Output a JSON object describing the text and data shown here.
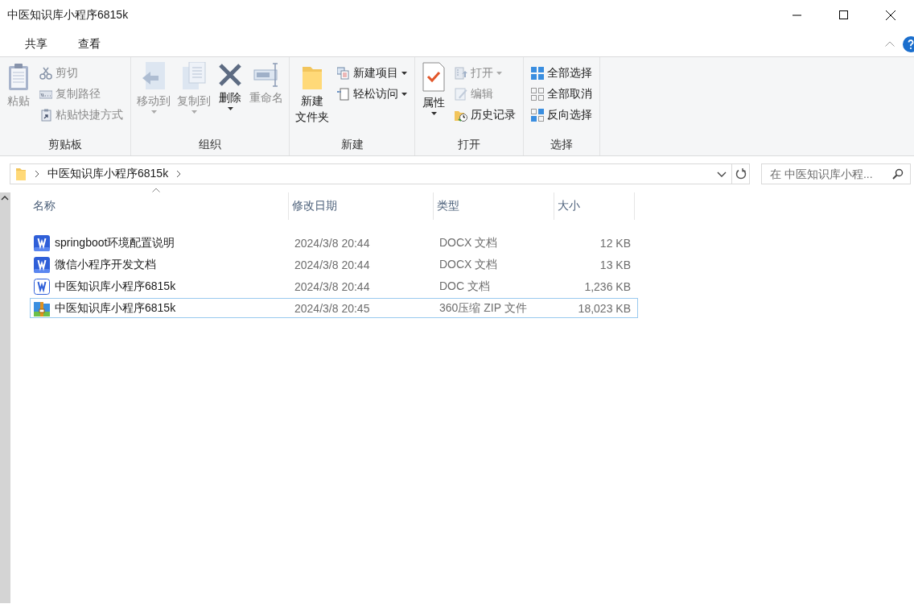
{
  "window": {
    "title": "中医知识库小程序6815k"
  },
  "ribbon_tabs": [
    {
      "label": "共享",
      "selected": false
    },
    {
      "label": "查看",
      "selected": false
    }
  ],
  "ribbon_groups": [
    {
      "label": "剪贴板",
      "items": [
        {
          "kind": "large",
          "label": "粘贴",
          "disabled": true,
          "dropdown": false
        },
        {
          "kind": "small",
          "label": "剪切",
          "disabled": true,
          "dropdown": false
        },
        {
          "kind": "small",
          "label": "复制路径",
          "disabled": true,
          "dropdown": false
        },
        {
          "kind": "small",
          "label": "粘贴快捷方式",
          "disabled": true,
          "dropdown": false
        }
      ]
    },
    {
      "label": "组织",
      "items": [
        {
          "kind": "large",
          "label": "移动到",
          "disabled": true,
          "dropdown": true
        },
        {
          "kind": "large",
          "label": "复制到",
          "disabled": true,
          "dropdown": true
        },
        {
          "kind": "large",
          "label": "删除",
          "disabled": false,
          "dropdown": true
        },
        {
          "kind": "large",
          "label": "重命名",
          "disabled": true,
          "dropdown": false
        }
      ]
    },
    {
      "label": "新建",
      "items": [
        {
          "kind": "large",
          "label": [
            "新建",
            "文件夹"
          ],
          "disabled": false,
          "dropdown": false
        },
        {
          "kind": "small",
          "label": "新建项目",
          "disabled": false,
          "dropdown": true
        },
        {
          "kind": "small",
          "label": "轻松访问",
          "disabled": false,
          "dropdown": true
        }
      ]
    },
    {
      "label": "打开",
      "items": [
        {
          "kind": "large",
          "label": "属性",
          "disabled": false,
          "dropdown": true
        },
        {
          "kind": "small",
          "label": "打开",
          "disabled": true,
          "dropdown": true
        },
        {
          "kind": "small",
          "label": "编辑",
          "disabled": true,
          "dropdown": false
        },
        {
          "kind": "small",
          "label": "历史记录",
          "disabled": false,
          "dropdown": false
        }
      ]
    },
    {
      "label": "选择",
      "items": [
        {
          "kind": "small",
          "label": "全部选择",
          "disabled": false,
          "dropdown": false
        },
        {
          "kind": "small",
          "label": "全部取消",
          "disabled": false,
          "dropdown": false
        },
        {
          "kind": "small",
          "label": "反向选择",
          "disabled": false,
          "dropdown": false
        }
      ]
    }
  ],
  "address_bar": {
    "path": [
      "中医知识库小程序6815k"
    ]
  },
  "search": {
    "placeholder": "在 中医知识库小程..."
  },
  "file_list": {
    "columns": [
      "名称",
      "修改日期",
      "类型",
      "大小"
    ],
    "rows": [
      {
        "kind": "docx",
        "name": "springboot环境配置说明",
        "modified": "2024/3/8 20:44",
        "type": "DOCX 文档",
        "size": "12 KB",
        "selected": false
      },
      {
        "kind": "docx",
        "name": "微信小程序开发文档",
        "modified": "2024/3/8 20:44",
        "type": "DOCX 文档",
        "size": "13 KB",
        "selected": false
      },
      {
        "kind": "doc",
        "name": "中医知识库小程序6815k",
        "modified": "2024/3/8 20:44",
        "type": "DOC 文档",
        "size": "1,236 KB",
        "selected": false
      },
      {
        "kind": "zip",
        "name": "中医知识库小程序6815k",
        "modified": "2024/3/8 20:45",
        "type": "360压缩 ZIP 文件",
        "size": "18,023 KB",
        "selected": true
      }
    ]
  }
}
